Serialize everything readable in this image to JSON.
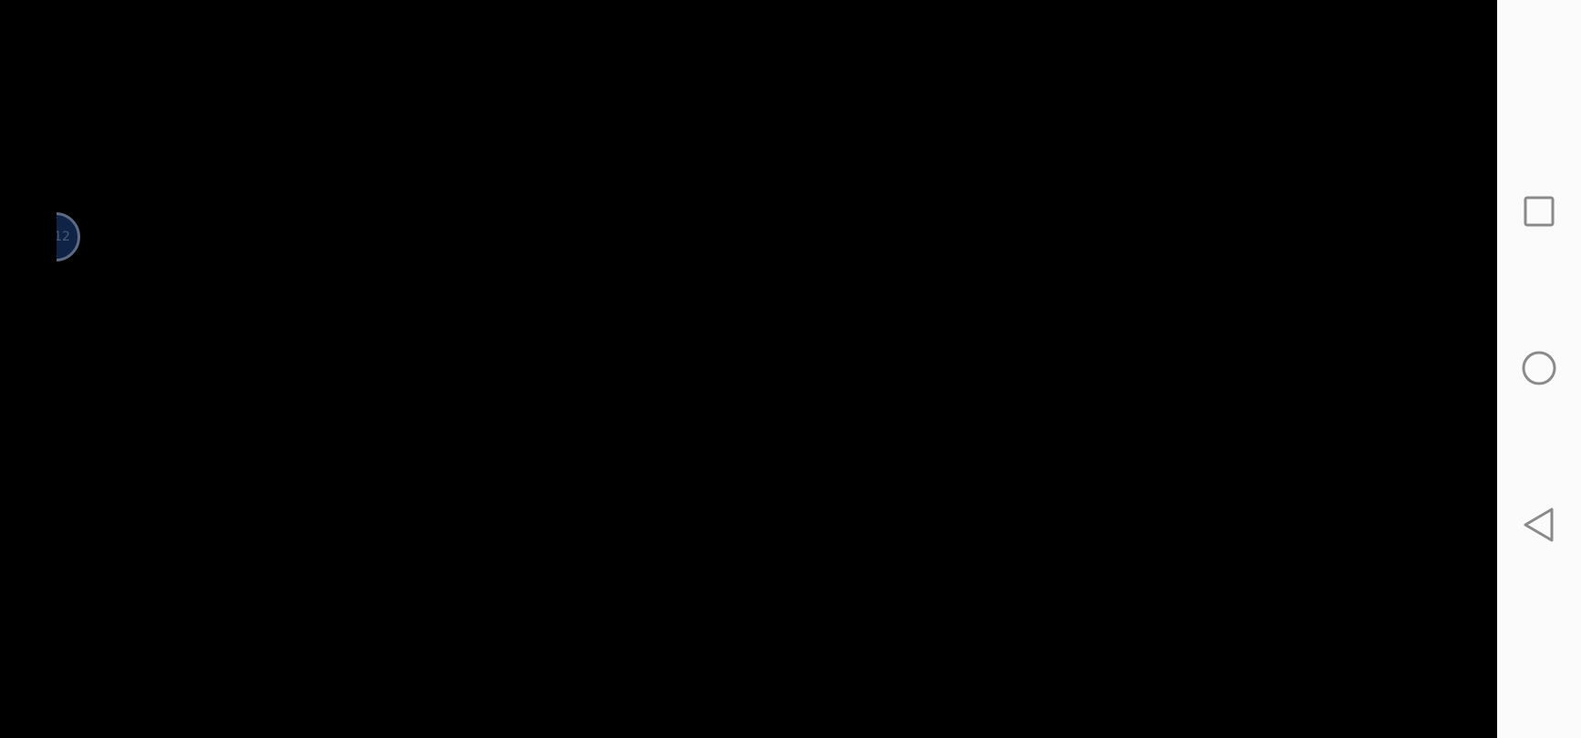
{
  "screen": {
    "background_color": "#000000"
  },
  "edge_badge": {
    "label": "12",
    "fill_color": "#0f2346",
    "ring_color": "#5c6b82"
  },
  "navbar": {
    "background_color": "#fbfbfb",
    "icon_color": "#8a8a8a",
    "buttons": [
      {
        "icon": "square-icon",
        "action": "recents"
      },
      {
        "icon": "circle-icon",
        "action": "home"
      },
      {
        "icon": "triangle-left-icon",
        "action": "back"
      }
    ]
  }
}
